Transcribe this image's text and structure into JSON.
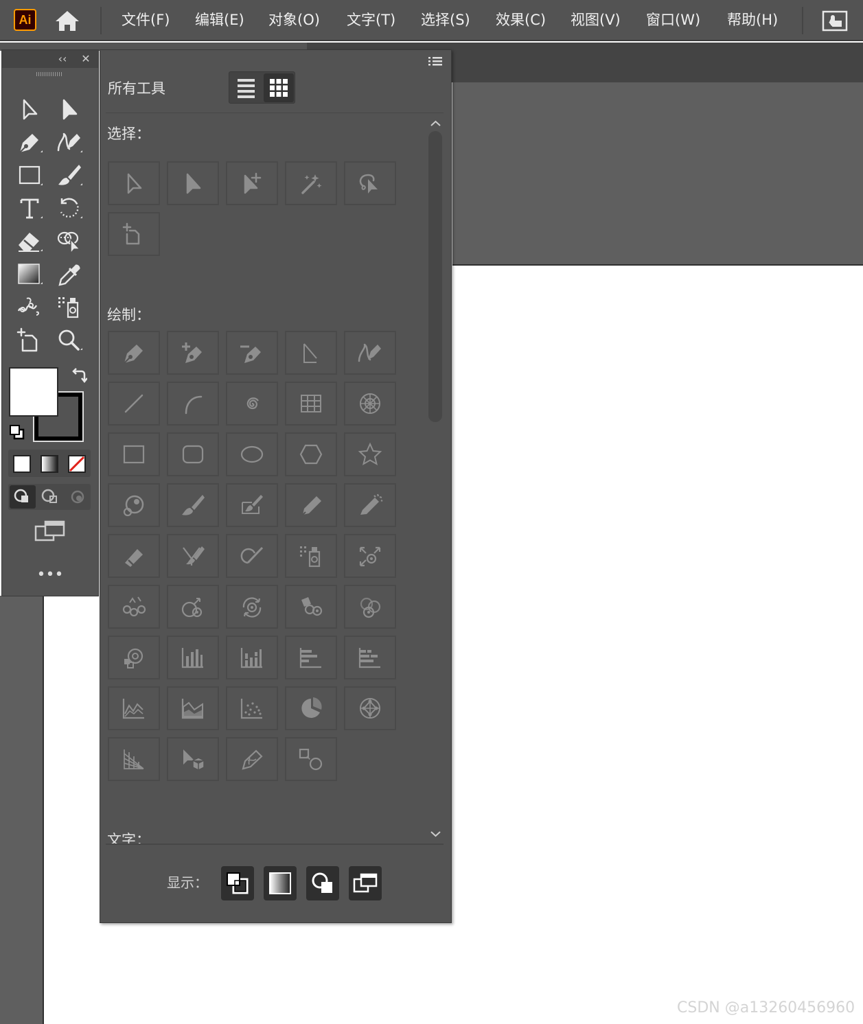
{
  "app": {
    "logo_text": "Ai"
  },
  "menubar": {
    "items": [
      "文件(F)",
      "编辑(E)",
      "对象(O)",
      "文字(T)",
      "选择(S)",
      "效果(C)",
      "视图(V)",
      "窗口(W)",
      "帮助(H)"
    ]
  },
  "toolbar": {
    "collapse_label": "‹‹",
    "close_label": "✕",
    "tools": [
      "selection-tool",
      "direct-selection-tool",
      "pen-tool",
      "curvature-tool",
      "rectangle-tool",
      "paintbrush-tool",
      "type-tool",
      "rotate-tool",
      "eraser-tool",
      "shape-builder-tool",
      "gradient-tool",
      "eyedropper-tool",
      "puppet-warp-tool",
      "symbol-sprayer-tool",
      "artboard-tool",
      "zoom-tool"
    ],
    "more_label": "•••"
  },
  "colors": {
    "accent": "#ff9a00",
    "ui_bg": "#535353",
    "panel_bg": "#535353",
    "canvas": "#ffffff",
    "none_red": "#e0211a"
  },
  "panel": {
    "title": "所有工具",
    "sections": [
      {
        "label": "选择：",
        "tools": [
          "selection-tool",
          "direct-selection-tool",
          "group-selection-tool",
          "magic-wand-tool",
          "lasso-tool",
          "artboard-tool"
        ]
      },
      {
        "label": "绘制：",
        "tools": [
          "pen-tool",
          "add-anchor-point-tool",
          "delete-anchor-point-tool",
          "anchor-point-tool",
          "curvature-tool",
          "line-segment-tool",
          "arc-tool",
          "spiral-tool",
          "rectangular-grid-tool",
          "polar-grid-tool",
          "rectangle-tool",
          "rounded-rectangle-tool",
          "ellipse-tool",
          "polygon-tool",
          "star-tool",
          "flare-tool",
          "paintbrush-tool",
          "blob-brush-tool",
          "pencil-tool",
          "smooth-tool",
          "path-eraser-tool",
          "join-tool",
          "shaper-tool",
          "symbol-sprayer-tool",
          "symbol-shifter-tool",
          "symbol-scruncher-tool",
          "symbol-sizer-tool",
          "symbol-spinner-tool",
          "symbol-stainer-tool",
          "symbol-screener-tool",
          "symbol-styler-tool",
          "column-graph-tool",
          "stacked-column-graph-tool",
          "bar-graph-tool",
          "stacked-bar-graph-tool",
          "line-graph-tool",
          "area-graph-tool",
          "scatter-graph-tool",
          "pie-graph-tool",
          "radar-graph-tool",
          "perspective-grid-tool",
          "perspective-selection-tool",
          "mesh-tool",
          "blend-tool"
        ]
      },
      {
        "label": "文字："
      }
    ],
    "show_label": "显示：",
    "show_buttons": [
      "fill-stroke-icon",
      "gradient-icon",
      "drawing-modes-icon",
      "screen-mode-icon"
    ]
  },
  "watermark": "CSDN @a13260456960"
}
